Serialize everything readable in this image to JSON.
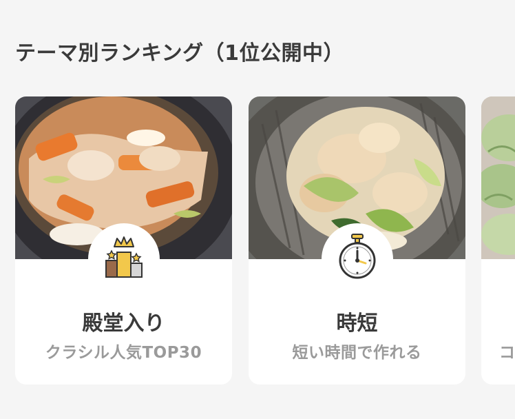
{
  "section": {
    "title": "テーマ別ランキング（1位公開中）"
  },
  "cards": [
    {
      "title": "殿堂入り",
      "subtitle": "クラシル人気TOP30",
      "icon": "podium-crown-icon"
    },
    {
      "title": "時短",
      "subtitle": "短い時間で作れる",
      "icon": "stopwatch-icon"
    },
    {
      "title": "",
      "subtitle": "コ",
      "icon": ""
    }
  ],
  "colors": {
    "background": "#f5f5f5",
    "card": "#ffffff",
    "title": "#3a3a3a",
    "subtitle": "#9a9a9a",
    "gold": "#f2c84b"
  }
}
